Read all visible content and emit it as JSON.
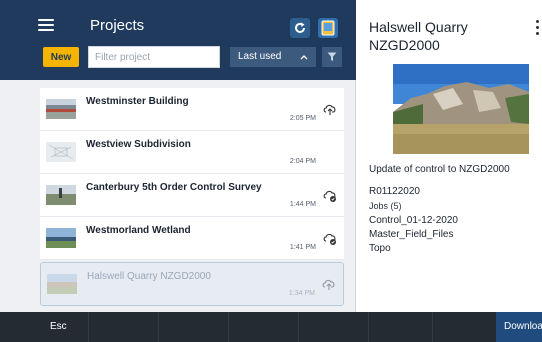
{
  "header": {
    "title": "Projects",
    "new_label": "New",
    "filter_placeholder": "Filter project",
    "sort_label": "Last used",
    "colors": {
      "header_bg": "#1f3a5c",
      "new_btn": "#f5b400"
    }
  },
  "projects": [
    {
      "name": "Westminster Building",
      "time": "2:05 PM",
      "cloud": "cloud-upload-icon"
    },
    {
      "name": "Westview Subdivision",
      "time": "2:04 PM",
      "cloud": ""
    },
    {
      "name": "Canterbury 5th Order Control Survey",
      "time": "1:44 PM",
      "cloud": "cloud-synced-icon"
    },
    {
      "name": "Westmorland Wetland",
      "time": "1:41 PM",
      "cloud": "cloud-synced-icon"
    },
    {
      "name": "Halswell Quarry NZGD2000",
      "time": "1:34 PM",
      "cloud": "cloud-upload-icon"
    }
  ],
  "detail": {
    "title_line1": "Halswell Quarry",
    "title_line2": "NZGD2000",
    "description": "Update of control to NZGD2000",
    "code": "R01122020",
    "jobs": "Jobs (5)",
    "items": [
      "Control_01-12-2020",
      "Master_Field_Files",
      "Topo"
    ]
  },
  "bottom": {
    "esc_label": "Esc",
    "download_label": "Download"
  }
}
